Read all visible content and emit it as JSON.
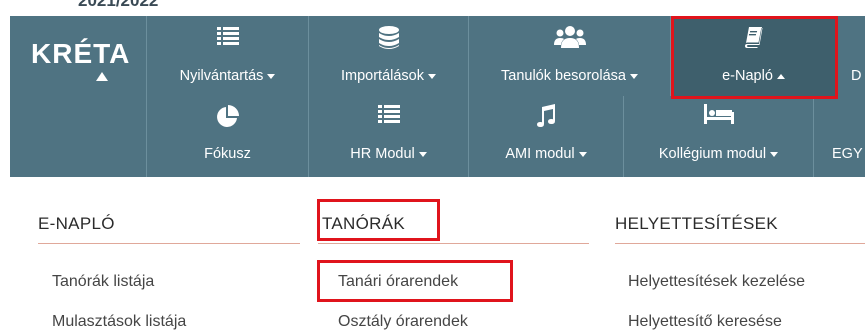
{
  "year": "2021/2022",
  "brand": "KRÉTA",
  "nav_row1": [
    {
      "label": "Nyilvántartás",
      "icon": "list-icon",
      "caret": "down"
    },
    {
      "label": "Importálások",
      "icon": "database-icon",
      "caret": "down"
    },
    {
      "label": "Tanulók besorolása",
      "icon": "users-icon",
      "caret": "down"
    },
    {
      "label": "e-Napló",
      "icon": "book-icon",
      "caret": "up"
    },
    {
      "label": "D"
    }
  ],
  "nav_row2": [
    {
      "label": "Fókusz",
      "icon": "pie-chart-icon"
    },
    {
      "label": "HR Modul",
      "icon": "list-icon",
      "caret": "down"
    },
    {
      "label": "AMI modul",
      "icon": "music-note-icon",
      "caret": "down"
    },
    {
      "label": "Kollégium modul",
      "icon": "bed-icon",
      "caret": "down"
    },
    {
      "label": "EGY"
    }
  ],
  "menu_columns": [
    {
      "title": "E-NAPLÓ",
      "links": [
        "Tanórák listája",
        "Mulasztások listája"
      ]
    },
    {
      "title": "TANÓRÁK",
      "links": [
        "Tanári órarendek",
        "Osztály órarendek"
      ]
    },
    {
      "title": "HELYETTESÍTÉSEK",
      "links": [
        "Helyettesítések kezelése",
        "Helyettesítő keresése"
      ]
    }
  ],
  "colors": {
    "nav_bg": "#4f7382",
    "nav_active": "#3e5f6c",
    "highlight": "#e0141c",
    "divider": "#e0a89a"
  }
}
